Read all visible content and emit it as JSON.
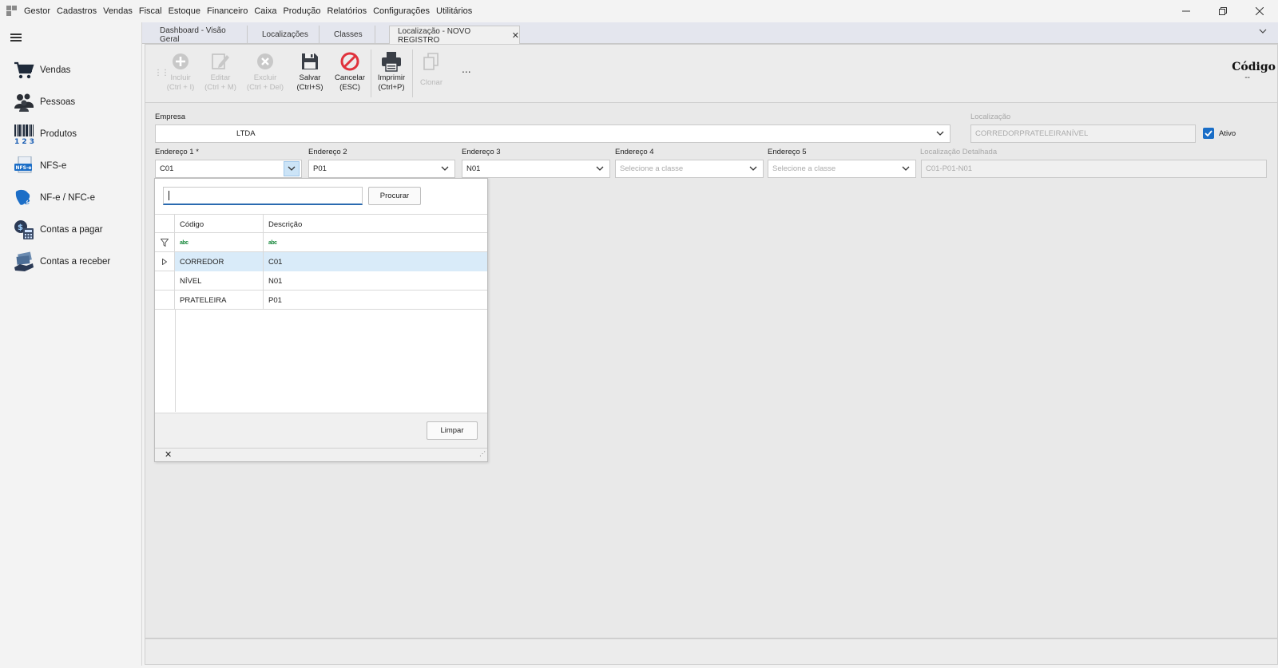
{
  "menubar": {
    "items": [
      "Gestor",
      "Cadastros",
      "Vendas",
      "Fiscal",
      "Estoque",
      "Financeiro",
      "Caixa",
      "Produção",
      "Relatórios",
      "Configurações",
      "Utilitários"
    ]
  },
  "sidebar": {
    "items": [
      {
        "label": "Vendas",
        "icon": "shopping-cart-icon"
      },
      {
        "label": "Pessoas",
        "icon": "people-icon"
      },
      {
        "label": "Produtos",
        "icon": "barcode-icon"
      },
      {
        "label": "NFS-e",
        "icon": "nfse-icon"
      },
      {
        "label": "NF-e / NFC-e",
        "icon": "nfe-icon"
      },
      {
        "label": "Contas a pagar",
        "icon": "bills-icon"
      },
      {
        "label": "Contas a receber",
        "icon": "receivables-icon"
      }
    ]
  },
  "tabs": [
    {
      "label": "Dashboard - Visão Geral"
    },
    {
      "label": "Localizações"
    },
    {
      "label": "Classes"
    },
    {
      "label": "Localização - NOVO REGISTRO",
      "active": true
    }
  ],
  "toolbar": {
    "incluir": "Incluir",
    "incluir_sc": "(Ctrl + I)",
    "editar": "Editar",
    "editar_sc": "(Ctrl + M)",
    "excluir": "Excluir",
    "excluir_sc": "(Ctrl + Del)",
    "salvar": "Salvar",
    "salvar_sc": "(Ctrl+S)",
    "cancelar": "Cancelar",
    "cancelar_sc": "(ESC)",
    "imprimir": "Imprimir",
    "imprimir_sc": "(Ctrl+P)",
    "clonar": "Clonar",
    "more": "..."
  },
  "codigo": {
    "label": "Código",
    "value": "--"
  },
  "form": {
    "empresa_label": "Empresa",
    "empresa_value": "LTDA",
    "localizacao_label": "Localização",
    "localizacao_value": "CORREDORPRATELEIRANÍVEL",
    "ativo_label": "Ativo",
    "end1_label": "Endereço 1 *",
    "end1_value": "C01",
    "end2_label": "Endereço 2",
    "end2_value": "P01",
    "end3_label": "Endereço 3",
    "end3_value": "N01",
    "end4_label": "Endereço 4",
    "end4_placeholder": "Selecione a classe",
    "end5_label": "Endereço 5",
    "end5_placeholder": "Selecione a classe",
    "locdet_label": "Localização Detalhada",
    "locdet_value": "C01-P01-N01"
  },
  "popup": {
    "search_value": "",
    "procurar": "Procurar",
    "col_codigo": "Código",
    "col_descricao": "Descrição",
    "filter_glyph": "abc",
    "rows": [
      {
        "codigo": "CORREDOR",
        "descricao": "C01"
      },
      {
        "codigo": "NÍVEL",
        "descricao": "N01"
      },
      {
        "codigo": "PRATELEIRA",
        "descricao": "P01"
      }
    ],
    "limpar": "Limpar"
  },
  "colors": {
    "accent": "#1a6ec7",
    "cancel": "#e0323c",
    "selected_row": "#d9ebf9"
  }
}
